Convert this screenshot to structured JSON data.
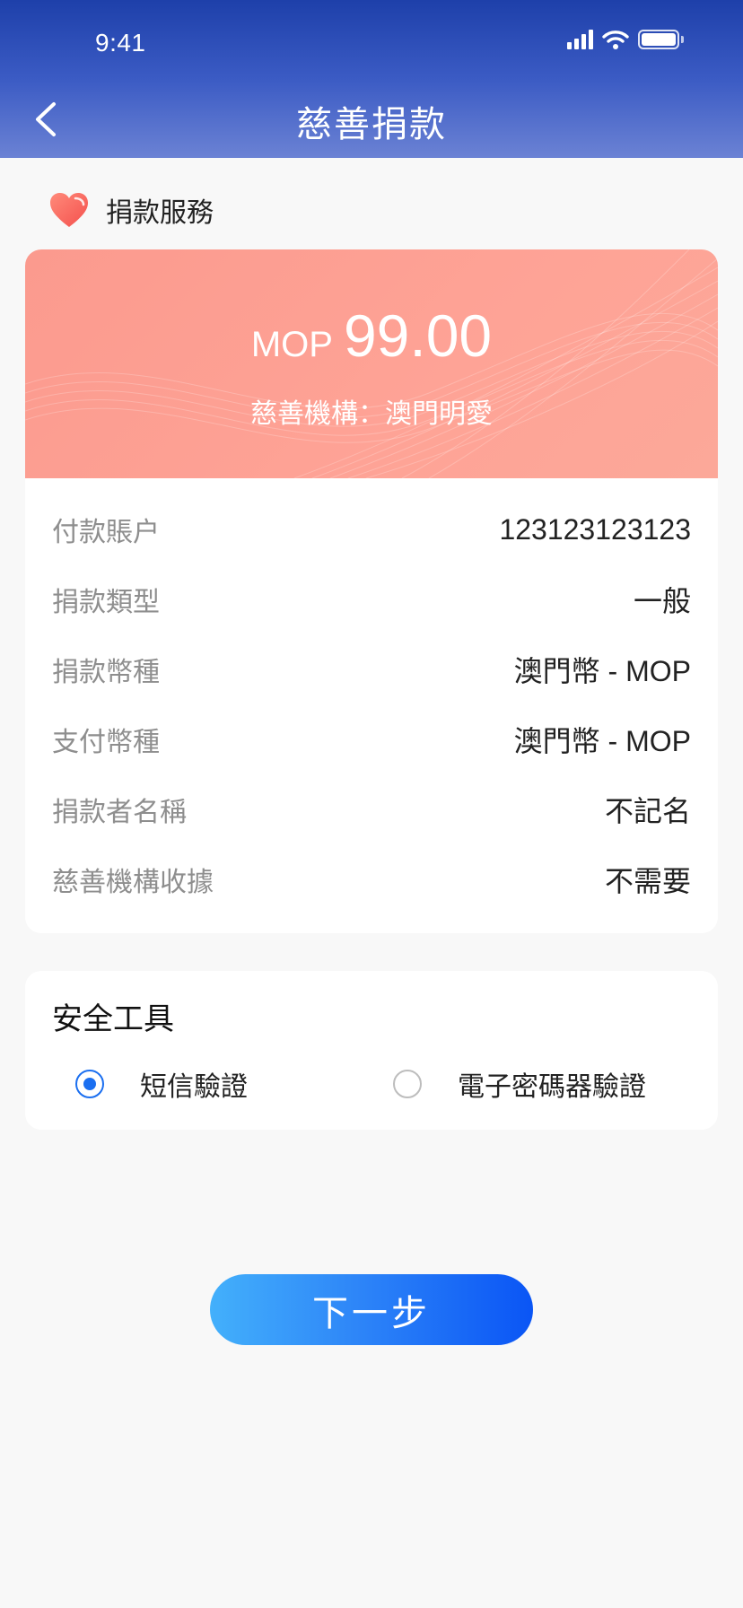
{
  "status_bar": {
    "time": "9:41"
  },
  "nav": {
    "title": "慈善捐款"
  },
  "section": {
    "title": "捐款服務"
  },
  "amount_banner": {
    "currency": "MOP",
    "amount": "99.00",
    "organization": "慈善機構：澳門明愛"
  },
  "details": [
    {
      "label": "付款賬户",
      "value": "123123123123"
    },
    {
      "label": "捐款類型",
      "value": "一般"
    },
    {
      "label": "捐款幣種",
      "value": "澳門幣 - MOP"
    },
    {
      "label": "支付幣種",
      "value": "澳門幣 - MOP"
    },
    {
      "label": "捐款者名稱",
      "value": "不記名"
    },
    {
      "label": "慈善機構收據",
      "value": "不需要"
    }
  ],
  "security": {
    "title": "安全工具",
    "options": [
      {
        "label": "短信驗證",
        "selected": true
      },
      {
        "label": "電子密碼器驗證",
        "selected": false
      }
    ]
  },
  "next_button": {
    "label": "下一步"
  },
  "colors": {
    "header_start": "#1e40aa",
    "header_end": "#6b82d4",
    "banner": "#fea396",
    "accent_blue": "#1b6ff0",
    "heart": "#f9665e"
  }
}
